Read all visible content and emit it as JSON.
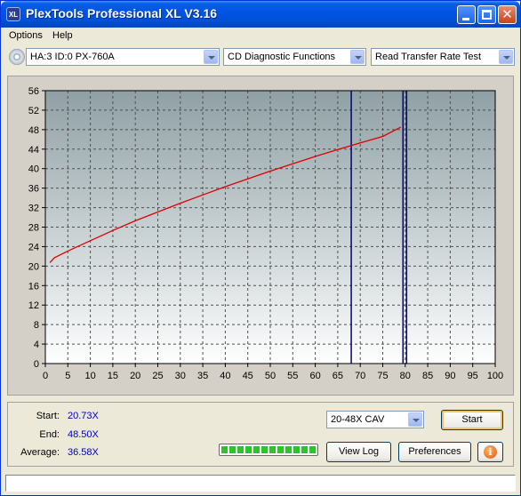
{
  "window": {
    "title": "PlexTools Professional XL V3.16",
    "app_icon_text": "XL"
  },
  "menu": {
    "items": [
      "Options",
      "Help"
    ]
  },
  "toolbar": {
    "drive": "HA:3 ID:0  PX-760A",
    "function": "CD Diagnostic Functions",
    "test": "Read Transfer Rate Test"
  },
  "chart_data": {
    "type": "line",
    "title": "",
    "xlabel": "",
    "ylabel": "",
    "xlim": [
      0,
      100
    ],
    "ylim": [
      0,
      56
    ],
    "x_ticks": [
      0,
      5,
      10,
      15,
      20,
      25,
      30,
      35,
      40,
      45,
      50,
      55,
      60,
      65,
      70,
      75,
      80,
      85,
      90,
      95,
      100
    ],
    "y_ticks": [
      0,
      4,
      8,
      12,
      16,
      20,
      24,
      28,
      32,
      36,
      40,
      44,
      48,
      52,
      56
    ],
    "grid": true,
    "series": [
      {
        "color": "#e00000",
        "x": [
          1,
          2,
          5,
          10,
          15,
          20,
          25,
          30,
          35,
          40,
          45,
          50,
          55,
          60,
          65,
          70,
          75,
          79
        ],
        "y": [
          20.73,
          21.7,
          23.1,
          25.2,
          27.3,
          29.3,
          31.1,
          32.9,
          34.6,
          36.3,
          37.9,
          39.5,
          41.0,
          42.5,
          43.9,
          45.3,
          46.6,
          48.5
        ]
      }
    ],
    "markers": {
      "x": [
        68,
        79.5,
        80.3
      ],
      "color": "#000080"
    },
    "colors": {
      "plot_top": "#8fa0a4",
      "plot_bottom": "#fefefe",
      "grid": "#505050"
    }
  },
  "stats": {
    "start_label": "Start:",
    "start_value": "20.73X",
    "end_label": "End:",
    "end_value": "48.50X",
    "average_label": "Average:",
    "average_value": "36.58X"
  },
  "controls": {
    "speed": "20-48X CAV",
    "start_button": "Start",
    "view_log_button": "View Log",
    "preferences_button": "Preferences",
    "info_icon": "i",
    "progress": 1.0
  },
  "status": {
    "text": ""
  }
}
